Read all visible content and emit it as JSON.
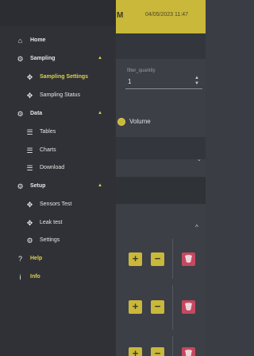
{
  "app": {
    "header": {
      "menu_fragment": "M",
      "datetime": "04/05/2023 11:47"
    },
    "form": {
      "filter_label": "filter_quantity",
      "filter_value": "1",
      "spin_up": "▲",
      "spin_down": "▼",
      "mode_label": "Volume",
      "expand_chevron": "⌄",
      "collapse_chevron": "^"
    },
    "rows": [
      {
        "plus": "+",
        "minus": "−",
        "delete": "🗑"
      },
      {
        "plus": "+",
        "minus": "−",
        "delete": "🗑"
      },
      {
        "plus": "+",
        "minus": "−",
        "delete": "🗑"
      }
    ]
  },
  "drawer": {
    "items": [
      {
        "name": "home",
        "label": "Home",
        "icon": "home-icon",
        "glyph": "⌂"
      },
      {
        "name": "sampling",
        "label": "Sampling",
        "icon": "gear-icon",
        "glyph": "⚙",
        "caret": "▲"
      },
      {
        "name": "sampling-settings",
        "label": "Sampling Settings",
        "icon": "move-icon",
        "glyph": "✥",
        "active": true
      },
      {
        "name": "sampling-status",
        "label": "Sampling Status",
        "icon": "move-icon",
        "glyph": "✥"
      },
      {
        "name": "data",
        "label": "Data",
        "icon": "gear-icon",
        "glyph": "⚙",
        "caret": "▲"
      },
      {
        "name": "tables",
        "label": "Tables",
        "icon": "list-icon",
        "glyph": "☰"
      },
      {
        "name": "charts",
        "label": "Charts",
        "icon": "list-icon",
        "glyph": "☰"
      },
      {
        "name": "download",
        "label": "Download",
        "icon": "list-icon",
        "glyph": "☰"
      },
      {
        "name": "setup",
        "label": "Setup",
        "icon": "gear-icon",
        "glyph": "⚙",
        "caret": "▲"
      },
      {
        "name": "sensors-test",
        "label": "Sensors Test",
        "icon": "move-icon",
        "glyph": "✥"
      },
      {
        "name": "leak-test",
        "label": "Leak test",
        "icon": "move-icon",
        "glyph": "✥"
      },
      {
        "name": "settings",
        "label": "Settings",
        "icon": "gear-icon",
        "glyph": "⚙"
      },
      {
        "name": "help",
        "label": "Help",
        "icon": "help-icon",
        "glyph": "?"
      },
      {
        "name": "info",
        "label": "Info",
        "icon": "info-icon",
        "glyph": "i"
      }
    ]
  },
  "colors": {
    "accent": "#c9b83a",
    "danger": "#c4485f",
    "drawer_bg": "#2f3136"
  }
}
